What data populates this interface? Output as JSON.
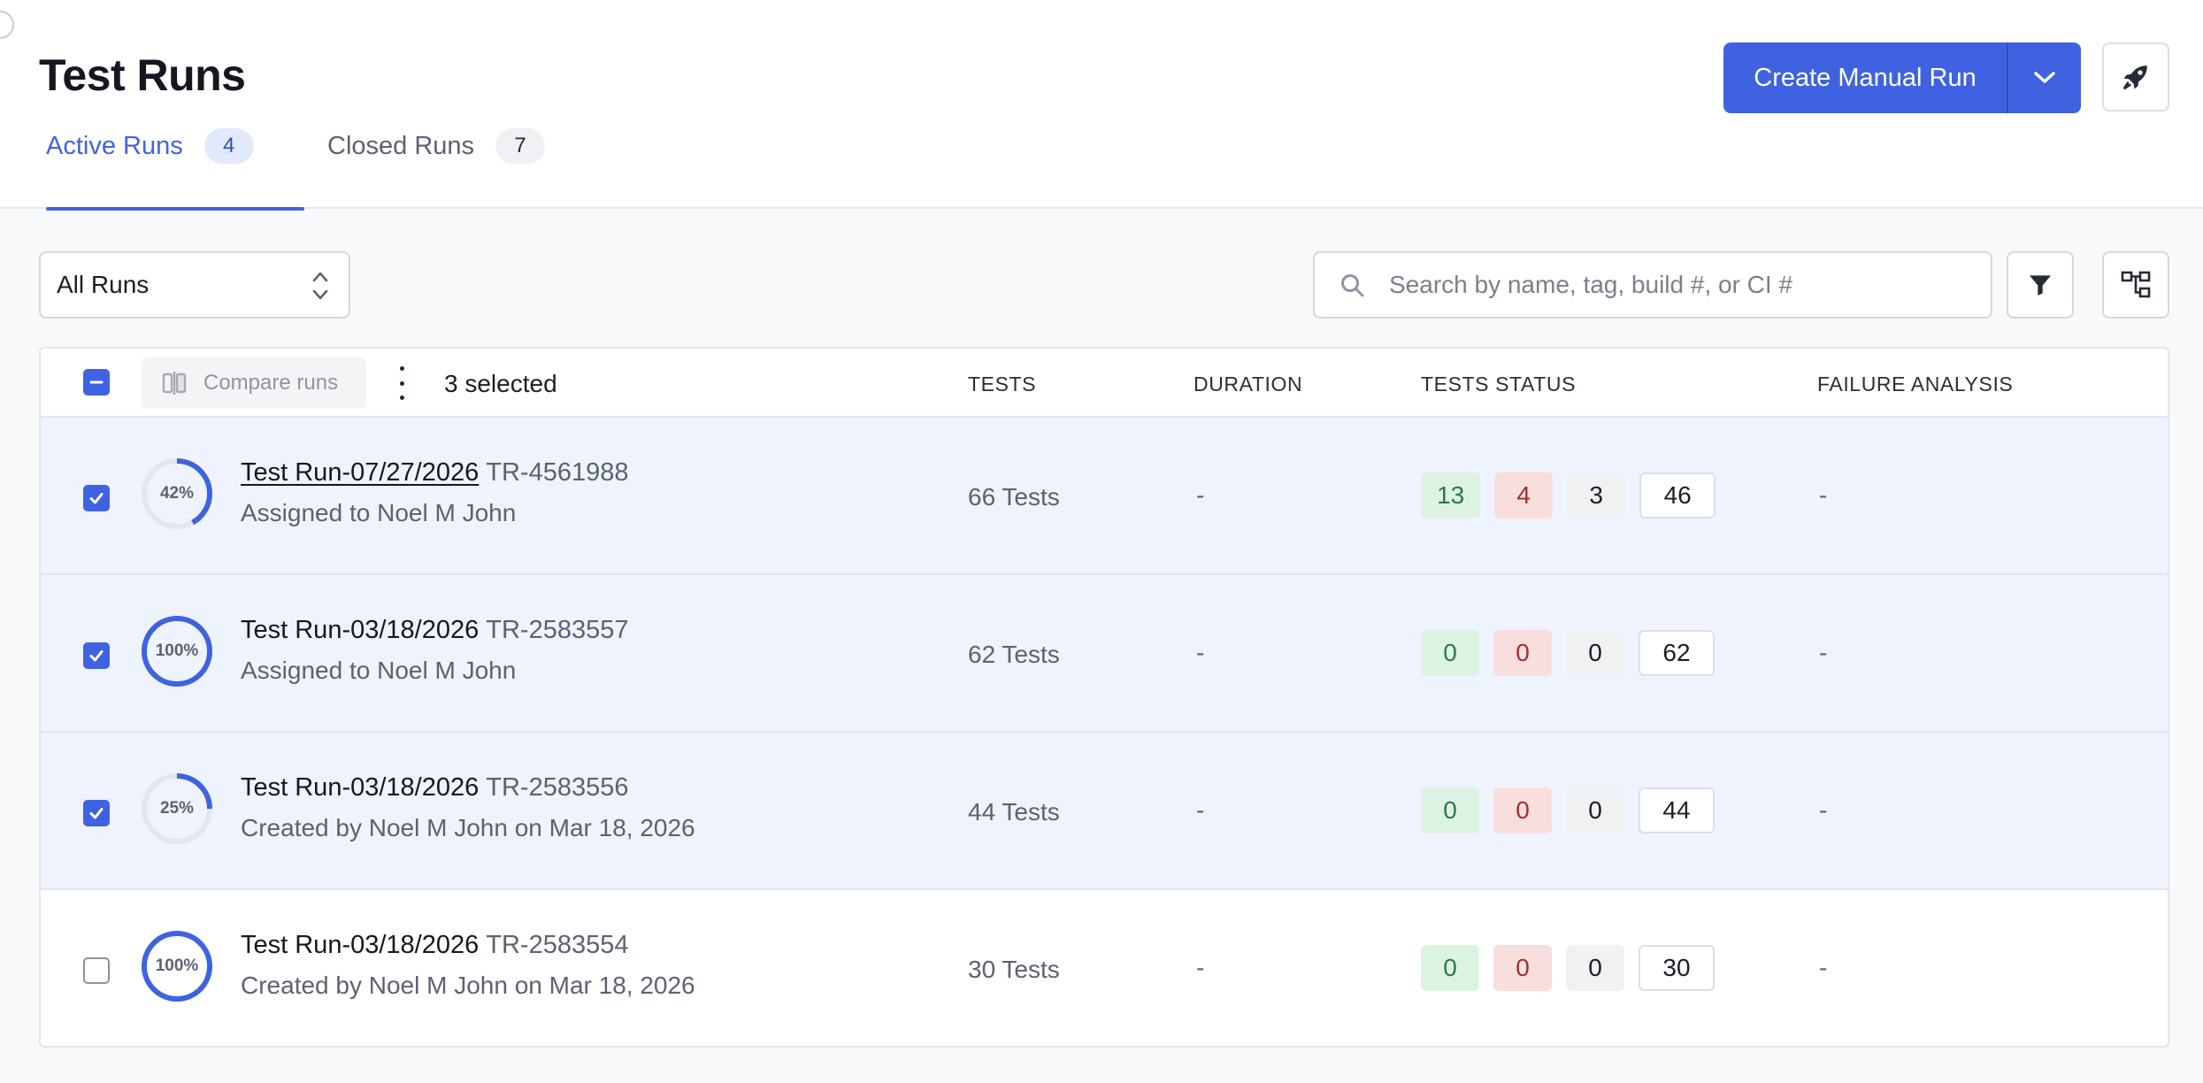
{
  "header": {
    "title": "Test Runs",
    "create_button": "Create Manual Run",
    "dropdown_icon": "chevron-down-icon",
    "rocket_icon": "rocket-icon"
  },
  "tabs": [
    {
      "label": "Active Runs",
      "count": "4",
      "active": true
    },
    {
      "label": "Closed Runs",
      "count": "7",
      "active": false
    }
  ],
  "toolbar": {
    "filter_select": "All Runs",
    "search_placeholder": "Search by name, tag, build #, or CI #",
    "search_value": "",
    "filter_icon": "filter-icon",
    "layout_icon": "hierarchy-icon"
  },
  "table": {
    "compare_label": "Compare runs",
    "selected_text": "3 selected",
    "columns": {
      "tests": "TESTS",
      "duration": "DURATION",
      "status": "TESTS STATUS",
      "failure": "FAILURE ANALYSIS"
    },
    "rows": [
      {
        "selected": true,
        "progress_label": "42%",
        "progress": 0.42,
        "name": "Test Run-07/27/2026",
        "id": "TR-4561988",
        "subtitle": "Assigned to Noel M John",
        "tests": "66 Tests",
        "duration": "-",
        "passed": "13",
        "failed": "4",
        "skipped": "3",
        "untested": "46",
        "failure_analysis": "-"
      },
      {
        "selected": true,
        "progress_label": "100%",
        "progress": 1.0,
        "name": "Test Run-03/18/2026",
        "id": "TR-2583557",
        "subtitle": "Assigned to Noel M John",
        "tests": "62 Tests",
        "duration": "-",
        "passed": "0",
        "failed": "0",
        "skipped": "0",
        "untested": "62",
        "failure_analysis": "-"
      },
      {
        "selected": true,
        "progress_label": "25%",
        "progress": 0.25,
        "name": "Test Run-03/18/2026",
        "id": "TR-2583556",
        "subtitle": "Created by Noel M John on Mar 18, 2026",
        "tests": "44 Tests",
        "duration": "-",
        "passed": "0",
        "failed": "0",
        "skipped": "0",
        "untested": "44",
        "failure_analysis": "-"
      },
      {
        "selected": false,
        "progress_label": "100%",
        "progress": 1.0,
        "name": "Test Run-03/18/2026",
        "id": "TR-2583554",
        "subtitle": "Created by Noel M John on Mar 18, 2026",
        "tests": "30 Tests",
        "duration": "-",
        "passed": "0",
        "failed": "0",
        "skipped": "0",
        "untested": "30",
        "failure_analysis": "-"
      }
    ]
  },
  "colors": {
    "accent": "#3f63e0",
    "row_selected_bg": "#eef3fd",
    "pass_bg": "#dcf3e4",
    "fail_bg": "#f9dede",
    "skip_bg": "#f0f1f3"
  }
}
